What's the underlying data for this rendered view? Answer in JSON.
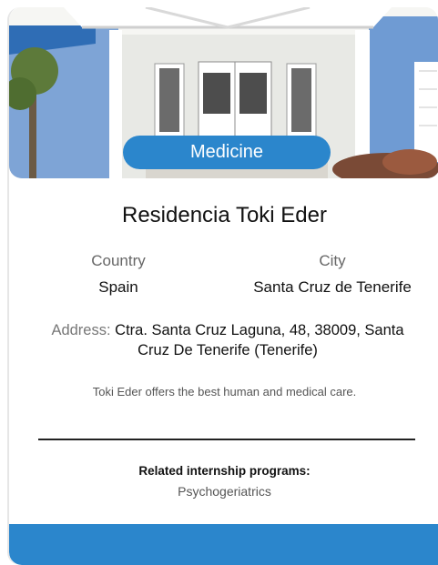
{
  "card": {
    "category": "Medicine",
    "title": "Residencia Toki Eder",
    "country": {
      "label": "Country",
      "value": "Spain"
    },
    "city": {
      "label": "City",
      "value": "Santa Cruz de Tenerife"
    },
    "address": {
      "label": "Address:",
      "value": "Ctra. Santa Cruz Laguna, 48, 38009, Santa Cruz De Tenerife (Tenerife)"
    },
    "description": "Toki Eder offers the best human and medical care.",
    "related": {
      "label": "Related internship programs:",
      "items": [
        "Psychogeriatrics"
      ]
    }
  },
  "colors": {
    "accent": "#2b86cc",
    "wall_blue": "#7ea4d6",
    "text_muted": "#666666"
  }
}
